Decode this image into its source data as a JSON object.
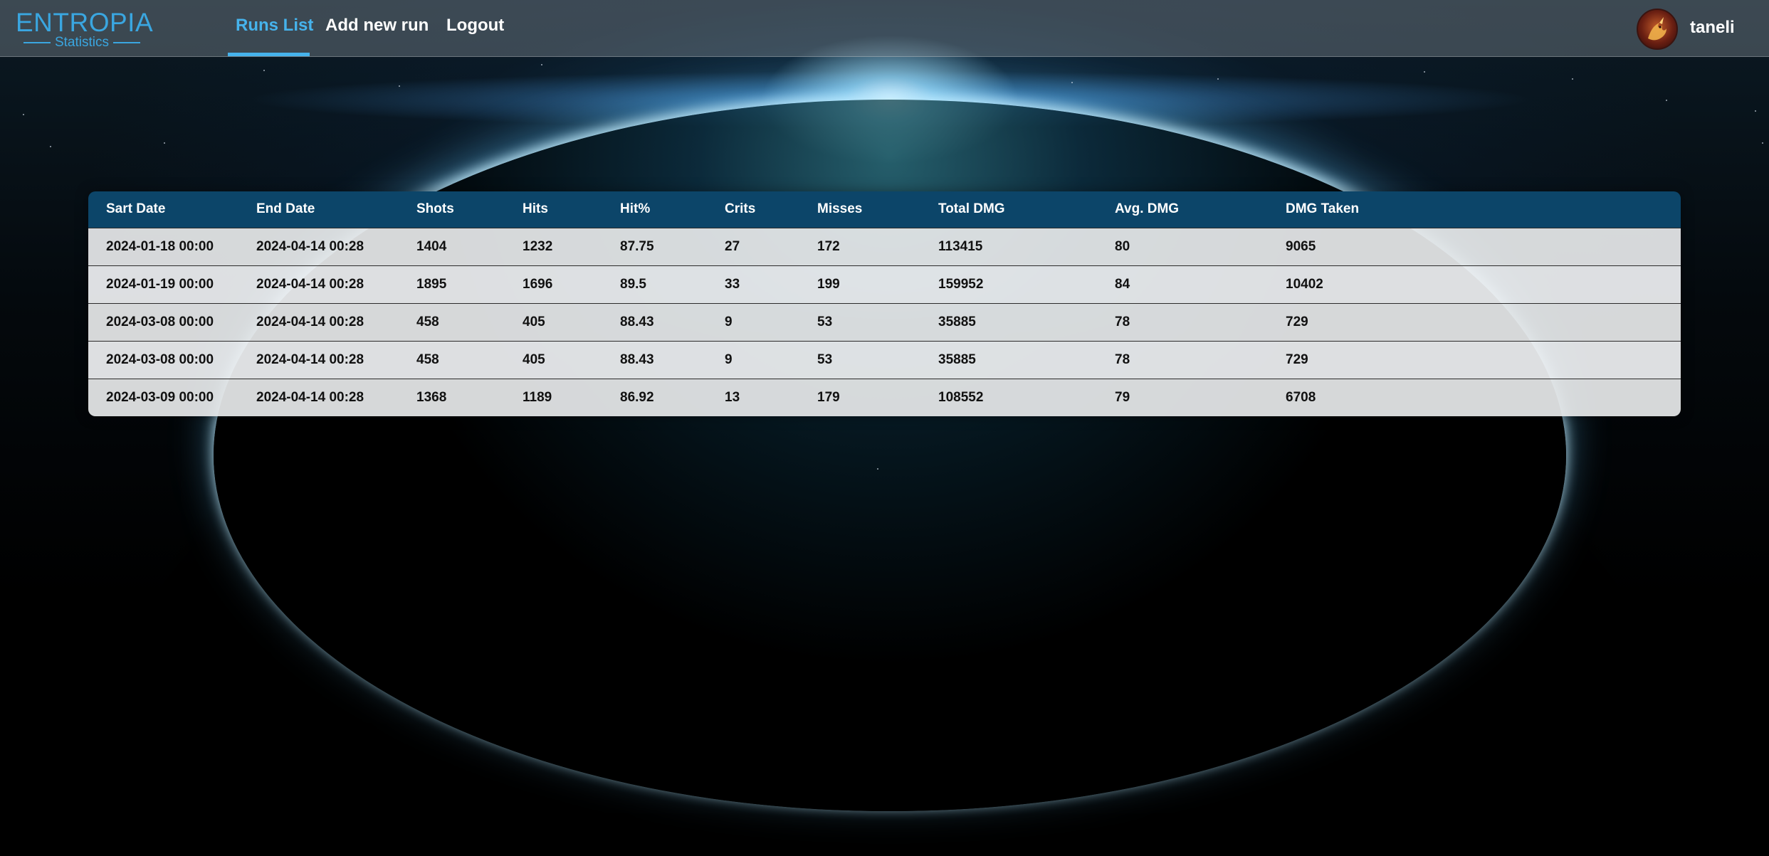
{
  "app": {
    "logo_title": "ENTROPIA",
    "logo_subtitle": "Statistics"
  },
  "nav": {
    "items": [
      {
        "label": "Runs List",
        "active": true
      },
      {
        "label": "Add new run",
        "active": false
      },
      {
        "label": "Logout",
        "active": false
      }
    ]
  },
  "user": {
    "name": "taneli",
    "avatar_icon": "dragon-avatar-icon"
  },
  "colors": {
    "accent": "#46b3ec",
    "header_bg": "#0c4569",
    "logo": "#3aa6e0"
  },
  "table": {
    "columns": [
      "Sart Date",
      "End Date",
      "Shots",
      "Hits",
      "Hit%",
      "Crits",
      "Misses",
      "Total DMG",
      "Avg. DMG",
      "DMG Taken"
    ],
    "rows": [
      [
        "2024-01-18 00:00",
        "2024-04-14 00:28",
        "1404",
        "1232",
        "87.75",
        "27",
        "172",
        "113415",
        "80",
        "9065"
      ],
      [
        "2024-01-19 00:00",
        "2024-04-14 00:28",
        "1895",
        "1696",
        "89.5",
        "33",
        "199",
        "159952",
        "84",
        "10402"
      ],
      [
        "2024-03-08 00:00",
        "2024-04-14 00:28",
        "458",
        "405",
        "88.43",
        "9",
        "53",
        "35885",
        "78",
        "729"
      ],
      [
        "2024-03-08 00:00",
        "2024-04-14 00:28",
        "458",
        "405",
        "88.43",
        "9",
        "53",
        "35885",
        "78",
        "729"
      ],
      [
        "2024-03-09 00:00",
        "2024-04-14 00:28",
        "1368",
        "1189",
        "86.92",
        "13",
        "179",
        "108552",
        "79",
        "6708"
      ]
    ]
  }
}
